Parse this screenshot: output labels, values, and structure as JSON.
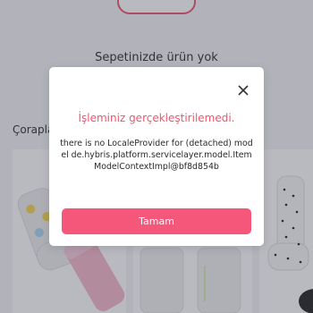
{
  "cart": {
    "empty_message": "Sepetinizde ürün yok"
  },
  "section": {
    "title": "Çorapla"
  },
  "dialog": {
    "title": "İşleminiz gerçekleştirilemedi.",
    "message": "there is no LocaleProvider for (detached) model de.hybris.platform.servicelayer.model.ItemModelContextImpl@bf8d854b",
    "ok_label": "Tamam",
    "close_icon": "close-icon"
  },
  "colors": {
    "accent": "#f0556e",
    "button": "#f5577a"
  }
}
